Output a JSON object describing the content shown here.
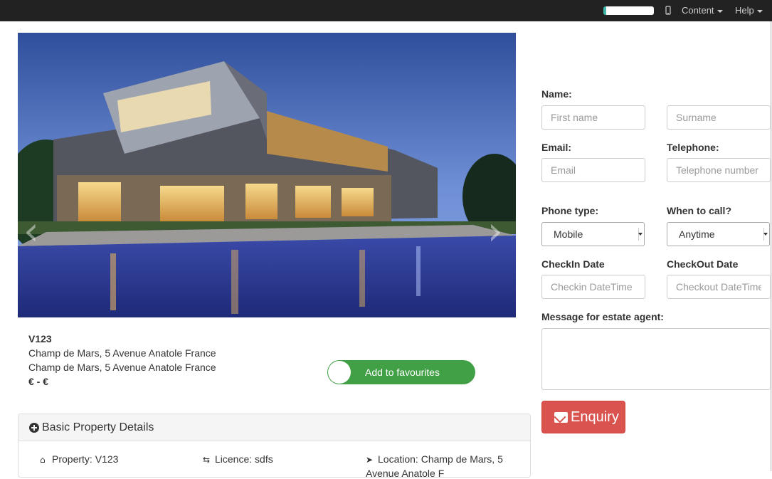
{
  "navbar": {
    "phone_icon": "mobile-phone-icon",
    "content_label": "Content",
    "help_label": "Help"
  },
  "hero": {
    "prev_glyph": "‹",
    "next_glyph": "›"
  },
  "property": {
    "id": "V123",
    "address_line_1": "Champ de Mars, 5 Avenue Anatole France",
    "address_line_2": "Champ de Mars, 5 Avenue Anatole France",
    "price": "€ - €"
  },
  "favourites": {
    "label": "Add to favourites",
    "color": "#41a046"
  },
  "details_panel": {
    "title": "Basic Property Details",
    "property": "Property: V123",
    "licence": "Licence: sdfs",
    "location_line_1": "Location: Champ de Mars, 5",
    "location_line_2": "Avenue Anatole F"
  },
  "form": {
    "name_label": "Name:",
    "first_name_placeholder": "First name",
    "surname_placeholder": "Surname",
    "email_label": "Email:",
    "email_placeholder": "Email",
    "telephone_label": "Telephone:",
    "telephone_placeholder": "Telephone number",
    "phone_type_label": "Phone type:",
    "phone_type_value": "Mobile",
    "when_to_call_label": "When to call?",
    "when_to_call_value": "Anytime",
    "checkin_label": "CheckIn Date",
    "checkin_placeholder": "Checkin DateTime",
    "checkout_label": "CheckOut Date",
    "checkout_placeholder": "Checkout DateTime",
    "message_label": "Message for estate agent:",
    "enquiry_label": "Enquiry",
    "enquiry_color": "#d9534f"
  }
}
